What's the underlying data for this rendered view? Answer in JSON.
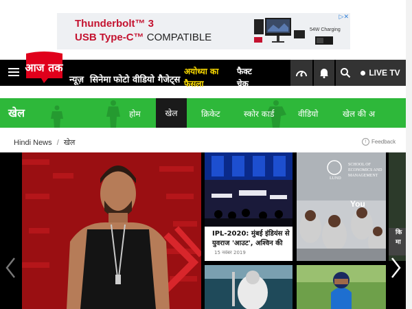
{
  "ad": {
    "line1": "Thunderbolt™ 3",
    "line2a": "USB Type-C™",
    "line2b": " COMPATIBLE",
    "charge_label": "54W Charging"
  },
  "brand": {
    "logo_text": "आज तक"
  },
  "nav": {
    "items": [
      {
        "label": "न्यूज़"
      },
      {
        "label": "सिनेमा"
      },
      {
        "label": "फोटो"
      },
      {
        "label": "वीडियो"
      },
      {
        "label": "गैजेट्स"
      }
    ],
    "highlight_1": "अयोध्या का",
    "highlight_2": "फैसला",
    "factcheck_1": "फैक्ट",
    "factcheck_2": "चेक",
    "live_label": "LIVE TV"
  },
  "section": {
    "title": "खेल",
    "tabs": [
      {
        "label": "होम"
      },
      {
        "label": "खेल"
      },
      {
        "label": "क्रिकेट"
      },
      {
        "label": "स्कोर कार्ड"
      },
      {
        "label": "वीडियो"
      },
      {
        "label": "खेल की अ"
      }
    ]
  },
  "breadcrumb": {
    "home": "Hindi News",
    "separator": "/",
    "current": "खेल"
  },
  "feedback_label": "Feedback",
  "gallery": {
    "card1_title": "IPL-2020: मुंबई इंडियंस से युवराज 'आउट', अश्विन की",
    "card1_date": "15 नवंबर 2019",
    "card2_overlay": "You",
    "card2_sign_1": "SCHOOL OF",
    "card2_sign_2": "ECONOMICS AND",
    "card2_sign_3": "MANAGEMENT",
    "card2_sign_4": "LUND",
    "edge_caption_1": "कि",
    "edge_caption_2": "मा"
  },
  "colors": {
    "brand_red": "#e0001b",
    "section_green": "#2eb83a",
    "highlight_yellow": "#ffde00",
    "nav_black": "#000000"
  }
}
